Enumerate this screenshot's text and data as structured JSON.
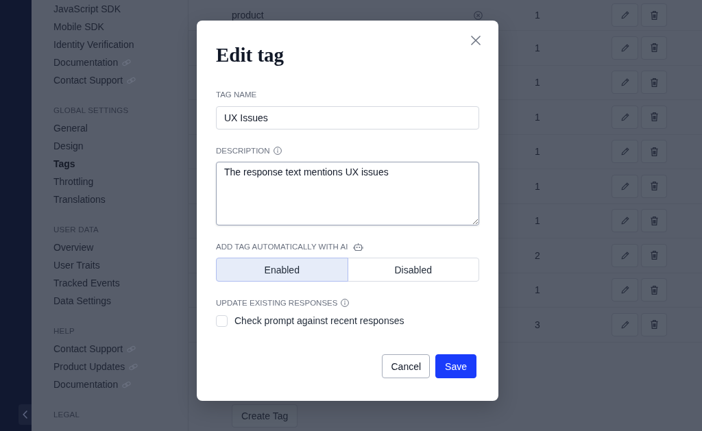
{
  "sidebar": {
    "sections": [
      {
        "items": [
          {
            "label": "JavaScript SDK",
            "external": false,
            "selected": false
          },
          {
            "label": "Mobile SDK",
            "external": false,
            "selected": false
          },
          {
            "label": "Identity Verification",
            "external": false,
            "selected": false
          },
          {
            "label": "Documentation",
            "external": true,
            "selected": false
          },
          {
            "label": "Contact Support",
            "external": true,
            "selected": false
          }
        ]
      },
      {
        "heading": "GLOBAL SETTINGS",
        "items": [
          {
            "label": "General",
            "external": false,
            "selected": false
          },
          {
            "label": "Design",
            "external": false,
            "selected": false
          },
          {
            "label": "Tags",
            "external": false,
            "selected": true
          },
          {
            "label": "Throttling",
            "external": false,
            "selected": false
          },
          {
            "label": "Translations",
            "external": false,
            "selected": false
          }
        ]
      },
      {
        "heading": "USER DATA",
        "items": [
          {
            "label": "Overview",
            "external": false,
            "selected": false
          },
          {
            "label": "User Traits",
            "external": false,
            "selected": false
          },
          {
            "label": "Tracked Events",
            "external": false,
            "selected": false
          },
          {
            "label": "Data Settings",
            "external": false,
            "selected": false
          }
        ]
      },
      {
        "heading": "HELP",
        "items": [
          {
            "label": "Contact Support",
            "external": true,
            "selected": false
          },
          {
            "label": "Product Updates",
            "external": true,
            "selected": false
          },
          {
            "label": "Documentation",
            "external": true,
            "selected": false
          }
        ]
      },
      {
        "heading": "LEGAL"
      }
    ]
  },
  "table": {
    "rows": [
      {
        "column_1": "product",
        "column_3": "1"
      },
      {
        "column_3": "1"
      },
      {
        "column_3": "1"
      },
      {
        "column_3": "1"
      },
      {
        "column_3": "1"
      },
      {
        "column_3": "1"
      },
      {
        "column_3": "1"
      },
      {
        "column_3": "2"
      },
      {
        "column_3": "1"
      },
      {
        "column_3": "3"
      }
    ]
  },
  "create_button": {
    "label": "Create Tag"
  },
  "dialog": {
    "title": "Edit tag",
    "tag_name": {
      "label": "TAG NAME",
      "value": "UX Issues"
    },
    "description": {
      "label": "DESCRIPTION",
      "value": "The response text mentions UX issues",
      "focused": true
    },
    "auto_tag": {
      "label": "ADD TAG AUTOMATICALLY WITH AI",
      "options": [
        {
          "label": "Enabled",
          "selected": true
        },
        {
          "label": "Disabled",
          "selected": false
        }
      ]
    },
    "update_existing": {
      "label": "UPDATE EXISTING RESPONSES",
      "checkbox": {
        "label": "Check prompt against recent responses",
        "checked": false
      }
    },
    "buttons": [
      {
        "label": "Cancel",
        "kind": "secondary"
      },
      {
        "label": "Save",
        "kind": "primary"
      }
    ]
  }
}
